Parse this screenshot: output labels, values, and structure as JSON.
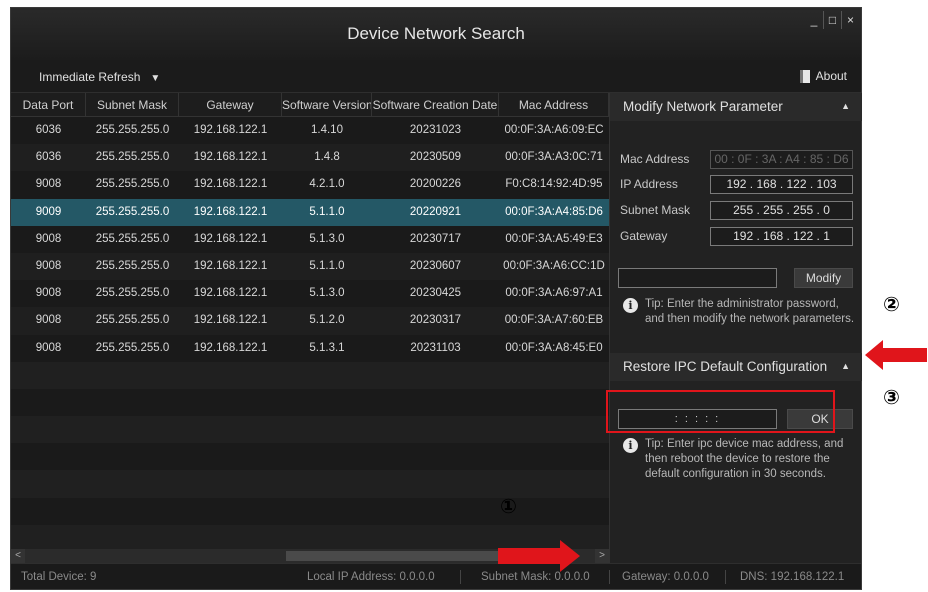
{
  "window": {
    "title": "Device Network Search",
    "controls": {
      "minimize": "_",
      "maximize": "□",
      "close": "×"
    }
  },
  "toolbar": {
    "refresh_label": "Immediate Refresh",
    "refresh_arrow": "▼",
    "about_label": "About"
  },
  "table": {
    "columns": [
      "Data Port",
      "Subnet Mask",
      "Gateway",
      "Software Version",
      "Software Creation Date",
      "Mac Address"
    ],
    "rows": [
      [
        "6036",
        "255.255.255.0",
        "192.168.122.1",
        "1.4.10",
        "20231023",
        "00:0F:3A:A6:09:EC"
      ],
      [
        "6036",
        "255.255.255.0",
        "192.168.122.1",
        "1.4.8",
        "20230509",
        "00:0F:3A:A3:0C:71"
      ],
      [
        "9008",
        "255.255.255.0",
        "192.168.122.1",
        "4.2.1.0",
        "20200226",
        "F0:C8:14:92:4D:95"
      ],
      [
        "9009",
        "255.255.255.0",
        "192.168.122.1",
        "5.1.1.0",
        "20220921",
        "00:0F:3A:A4:85:D6"
      ],
      [
        "9008",
        "255.255.255.0",
        "192.168.122.1",
        "5.1.3.0",
        "20230717",
        "00:0F:3A:A5:49:E3"
      ],
      [
        "9008",
        "255.255.255.0",
        "192.168.122.1",
        "5.1.1.0",
        "20230607",
        "00:0F:3A:A6:CC:1D"
      ],
      [
        "9008",
        "255.255.255.0",
        "192.168.122.1",
        "5.1.3.0",
        "20230425",
        "00:0F:3A:A6:97:A1"
      ],
      [
        "9008",
        "255.255.255.0",
        "192.168.122.1",
        "5.1.2.0",
        "20230317",
        "00:0F:3A:A7:60:EB"
      ],
      [
        "9008",
        "255.255.255.0",
        "192.168.122.1",
        "5.1.3.1",
        "20231103",
        "00:0F:3A:A8:45:E0"
      ]
    ],
    "selected_row": 3
  },
  "scrollbar": {
    "left": "<",
    "right": ">",
    "thumb": "|||"
  },
  "status": {
    "total": "Total Device: 9",
    "local_ip": "Local IP Address: 0.0.0.0",
    "subnet": "Subnet Mask: 0.0.0.0",
    "gateway": "Gateway: 0.0.0.0",
    "dns": "DNS: 192.168.122.1"
  },
  "modify_panel": {
    "header": "Modify Network Parameter",
    "header_arrow": "▲",
    "mac_label": "Mac Address",
    "mac_value": "00 : 0F : 3A : A4 : 85 : D6",
    "ip_label": "IP Address",
    "ip_value": "192 . 168 . 122 . 103",
    "subnet_label": "Subnet Mask",
    "subnet_value": "255 . 255 . 255 . 0",
    "gateway_label": "Gateway",
    "gateway_value": "192 . 168 . 122 . 1",
    "modify_button": "Modify",
    "tip": "Tip: Enter the administrator password, and then modify the network parameters."
  },
  "restore_panel": {
    "header": "Restore IPC Default Configuration",
    "header_arrow": "▲",
    "mac_placeholder": ":   :   :   :   :",
    "ok_button": "OK",
    "tip": "Tip: Enter ipc device mac address, and then reboot the device to restore the default configuration in 30 seconds."
  },
  "annotations": {
    "marker1": "①",
    "marker2": "②",
    "marker3": "③",
    "arrow_color": "#e0151b"
  }
}
